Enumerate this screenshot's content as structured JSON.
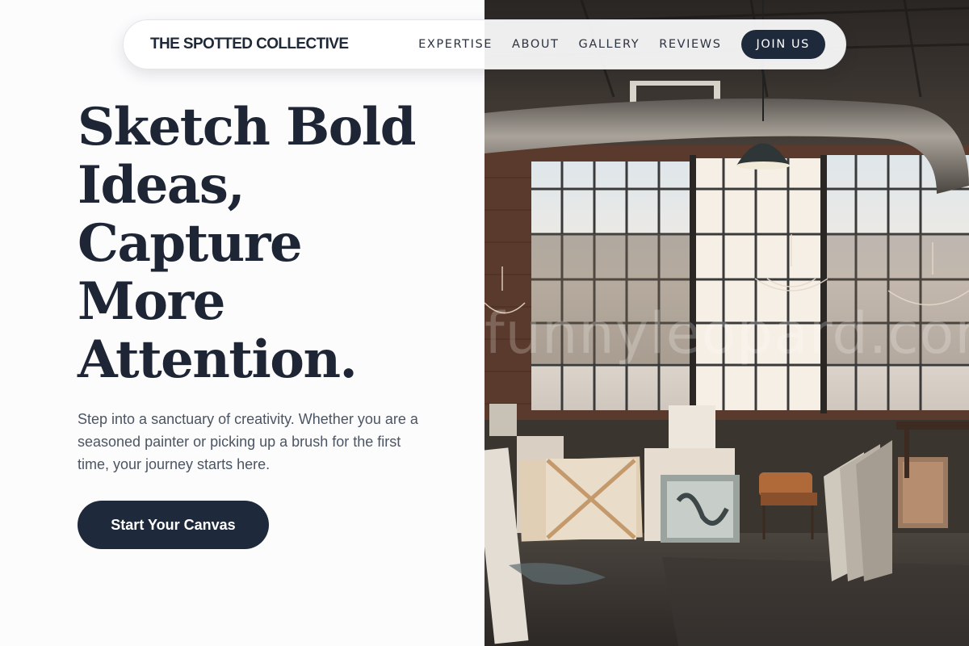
{
  "brand": {
    "name": "THE SPOTTED COLLECTIVE"
  },
  "nav": {
    "links": [
      "EXPERTISE",
      "ABOUT",
      "GALLERY",
      "REVIEWS"
    ],
    "cta_label": "JOIN US"
  },
  "hero": {
    "title_lines": [
      "Sketch Bold",
      "Ideas,",
      "Capture",
      "More",
      "Attention."
    ],
    "subtitle": "Step into a sanctuary of creativity. Whether you are a seasoned painter or picking up a brush for the first time, your journey starts here.",
    "cta_label": "Start Your Canvas"
  },
  "image": {
    "watermark": "funnyleopard.com",
    "description_icon": "art-studio-photo"
  },
  "colors": {
    "primary": "#1e293b",
    "heading": "#1e2535",
    "body_text": "#4b5563",
    "background": "#fcfcfd"
  }
}
